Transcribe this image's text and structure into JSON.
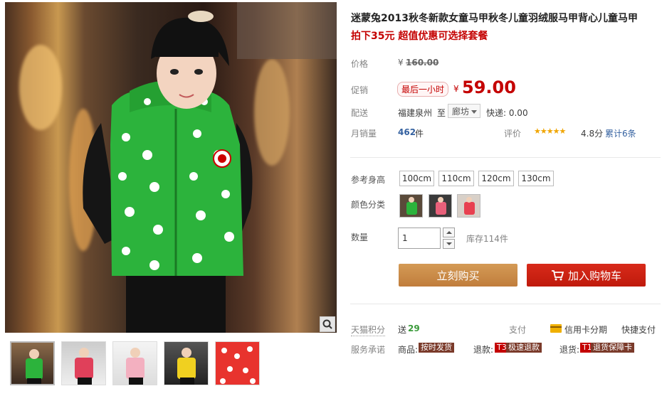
{
  "product": {
    "title": "迷蒙兔2013秋冬新款女童马甲秋冬儿童羽绒服马甲背心儿童马甲",
    "promo": "拍下35元 超值优惠可选择套餐"
  },
  "price": {
    "label": "价格",
    "currency": "¥",
    "original": "160.00",
    "promo_label": "促销",
    "promo_tag": "最后一小时",
    "promo_currency": "¥",
    "promo_price": "59.00"
  },
  "delivery": {
    "label": "配送",
    "from": "福建泉州",
    "to_word": "至",
    "to_city": "廊坊",
    "express": "快递: 0.00"
  },
  "sales": {
    "label": "月销量",
    "count": "462",
    "unit": "件",
    "rating_label": "评价",
    "stars": 4.8,
    "score": "4.8分",
    "reviews": "累计6条"
  },
  "options": {
    "height_label": "参考身高",
    "sizes": [
      "100cm",
      "110cm",
      "120cm",
      "130cm"
    ],
    "color_label": "颜色分类",
    "colors": [
      "green",
      "pink-white",
      "pink-red"
    ],
    "qty_label": "数量",
    "qty_value": "1",
    "stock": "库存114件"
  },
  "actions": {
    "buy": "立刻购买",
    "cart": "加入购物车"
  },
  "bottom": {
    "points_label": "天猫积分",
    "points_prefix": "送",
    "points_value": "29",
    "pay_label": "支付",
    "credit": "信用卡分期",
    "quickpay": "快捷支付",
    "service_label": "服务承诺",
    "goods_prefix": "商品:",
    "goods_badge": "按时发货",
    "refund_prefix": "退款:",
    "refund_code": "T3",
    "refund_badge": "极速退款",
    "return_prefix": "退货:",
    "return_code": "T1",
    "return_badge": "退货保障卡"
  },
  "colors": {
    "accent_red": "#c40000",
    "buy_orange": "#c98c48",
    "cart_red": "#c8200f",
    "vest_green": "#2cb33c",
    "star_orange": "#f0a500"
  }
}
